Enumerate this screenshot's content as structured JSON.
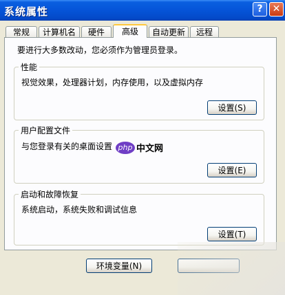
{
  "window": {
    "title": "系统属性",
    "help_glyph": "?",
    "close_glyph": "✕"
  },
  "tabs": [
    {
      "label": "常规"
    },
    {
      "label": "计算机名"
    },
    {
      "label": "硬件"
    },
    {
      "label": "高级"
    },
    {
      "label": "自动更新"
    },
    {
      "label": "远程"
    }
  ],
  "active_tab": "高级",
  "intro": "要进行大多数改动，您必须作为管理员登录。",
  "groups": [
    {
      "title": "性能",
      "description": "视觉效果，处理器计划，内存使用，以及虚拟内存",
      "button": "设置(S)"
    },
    {
      "title": "用户配置文件",
      "description": "与您登录有关的桌面设置",
      "button": "设置(E)"
    },
    {
      "title": "启动和故障恢复",
      "description": "系统启动，系统失败和调试信息",
      "button": "设置(T)"
    }
  ],
  "env_button": "环境变量(N)",
  "watermark": {
    "logo": "php",
    "text": "中文网"
  },
  "colors": {
    "title_bar": "#0554d8",
    "active_tab_accent": "#ffc83c",
    "background": "#ece9d8"
  }
}
